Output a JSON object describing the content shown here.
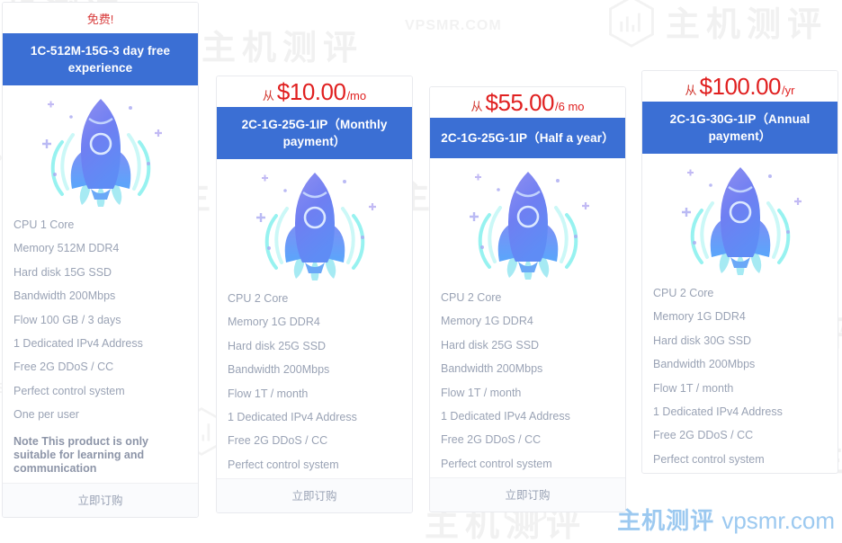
{
  "page": {
    "brand_cn": "主机测评",
    "brand_domain": "vpsmr.com",
    "watermark_cn": "主机测评",
    "watermark_latin": "VPSMR.COM",
    "accent_blue": "#3b6fd4",
    "price_red": "#e02020",
    "feature_gray": "#9aa3b5"
  },
  "cards": [
    {
      "id": "free",
      "price_label": "免费!",
      "price_from": "",
      "price_amount": "",
      "price_unit": "",
      "title": "1C-512M-15G-3 day free experience",
      "icon": "rocket-illustration",
      "features": [
        "CPU 1 Core",
        "Memory 512M DDR4",
        "Hard disk 15G SSD",
        "Bandwidth 200Mbps",
        "Flow 100 GB / 3 days",
        "1 Dedicated IPv4 Address",
        "Free 2G DDoS / CC",
        "Perfect control system",
        "One per user"
      ],
      "note": "Note This product is only suitable for learning and communication",
      "order_label": "立即订购"
    },
    {
      "id": "monthly",
      "price_label": "",
      "price_from": "从",
      "price_amount": "$10.00",
      "price_unit": "/mo",
      "title": "2C-1G-25G-1IP（Monthly payment）",
      "icon": "rocket-illustration",
      "features": [
        "CPU 2 Core",
        "Memory 1G DDR4",
        "Hard disk 25G SSD",
        "Bandwidth 200Mbps",
        "Flow 1T / month",
        "1 Dedicated IPv4 Address",
        "Free 2G DDoS / CC",
        "Perfect control system"
      ],
      "note": "",
      "order_label": "立即订购"
    },
    {
      "id": "half-year",
      "price_label": "",
      "price_from": "从",
      "price_amount": "$55.00",
      "price_unit": "/6 mo",
      "title": "2C-1G-25G-1IP（Half a year）",
      "icon": "rocket-illustration",
      "features": [
        "CPU 2 Core",
        "Memory 1G DDR4",
        "Hard disk 25G SSD",
        "Bandwidth 200Mbps",
        "Flow 1T / month",
        "1 Dedicated IPv4 Address",
        "Free 2G DDoS / CC",
        "Perfect control system"
      ],
      "note": "",
      "order_label": "立即订购"
    },
    {
      "id": "annual",
      "price_label": "",
      "price_from": "从",
      "price_amount": "$100.00",
      "price_unit": "/yr",
      "title": "2C-1G-30G-1IP（Annual payment）",
      "icon": "rocket-illustration",
      "features": [
        "CPU 2 Core",
        "Memory 1G DDR4",
        "Hard disk 30G SSD",
        "Bandwidth 200Mbps",
        "Flow 1T / month",
        "1 Dedicated IPv4 Address",
        "Free 2G DDoS / CC",
        "Perfect control system"
      ],
      "note": "",
      "order_label": ""
    }
  ]
}
